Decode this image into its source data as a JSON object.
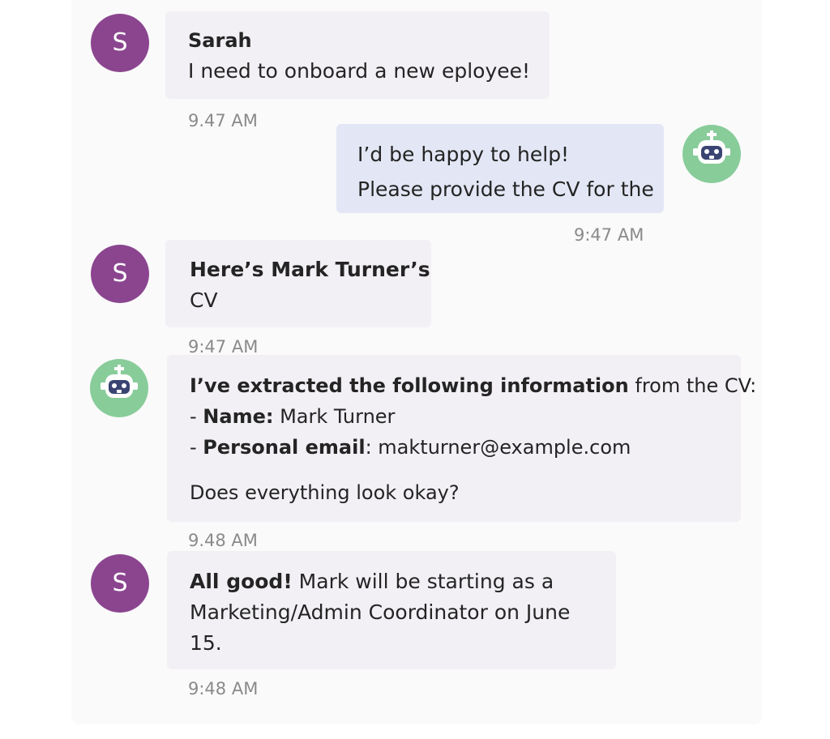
{
  "messages": [
    {
      "sender": "Sarah",
      "avatar_initial": "S",
      "text": "I need to onboard a new eployee!",
      "time": "9.47 AM"
    },
    {
      "sender_icon": "robot-icon",
      "lines": [
        "I’d be happy to help!",
        "Please provide the CV for the"
      ],
      "time": "9:47 AM"
    },
    {
      "avatar_initial": "S",
      "bold_line": "Here’s Mark Turner’s",
      "line2": "CV",
      "time": "9:47 AM"
    },
    {
      "sender_icon": "robot-icon",
      "intro_bold": "I’ve extracted the following information",
      "intro_rest": " from the CV:",
      "fields": [
        {
          "bullet": "- ",
          "label": "Name:",
          "value": " Mark Turner"
        },
        {
          "bullet": "- ",
          "label": "Personal email",
          "value": ": makturner@example.com"
        }
      ],
      "question": "Does everything look okay?",
      "time": "9.48 AM"
    },
    {
      "avatar_initial": "S",
      "bold": "All good!",
      "line1_rest": " Mark will be starting as a",
      "line2": "Marketing/Admin Coordinator on June",
      "line3": "15.",
      "time": "9:48 AM"
    }
  ],
  "colors": {
    "user_avatar": "#8b458f",
    "bot_avatar": "#88cc9a",
    "bot_face": "#3a4472",
    "incoming_bubble": "#f2f0f5",
    "outgoing_bubble": "#e3e7f5",
    "timestamp": "#8a8a8a"
  }
}
